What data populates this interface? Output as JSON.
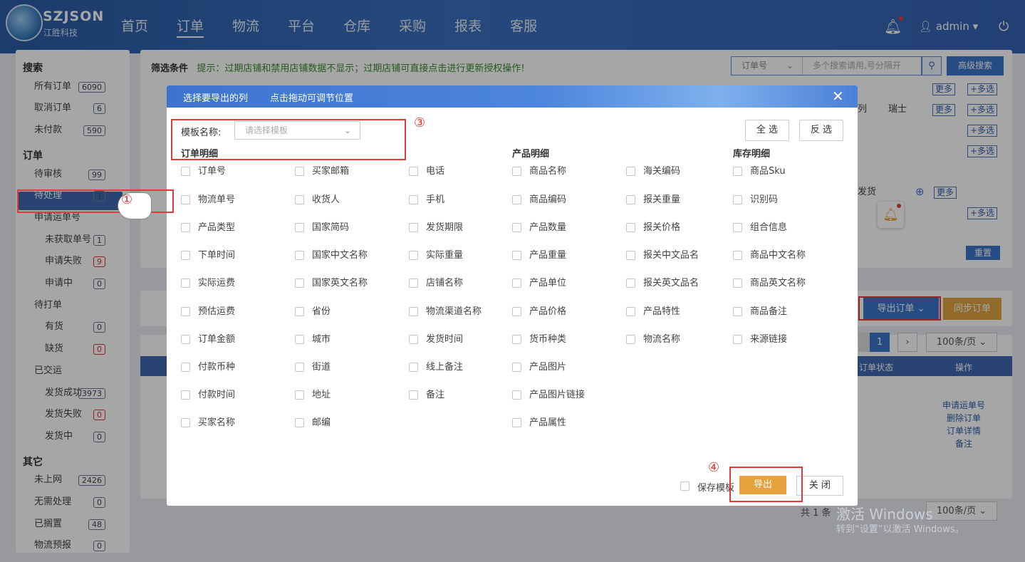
{
  "app": {
    "brand": "SZJSON",
    "brand_sub": "江胜科技"
  },
  "nav": {
    "items": [
      "首页",
      "订单",
      "物流",
      "平台",
      "仓库",
      "采购",
      "报表",
      "客服"
    ],
    "active_index": 1
  },
  "header": {
    "user": "admin",
    "user_icon": "user-icon",
    "bell_icon": "bell-icon",
    "power_icon": "power-icon"
  },
  "sidebar": {
    "sections": [
      {
        "title": "搜索",
        "items": [
          {
            "label": "所有订单",
            "count": "6090"
          },
          {
            "label": "取消订单",
            "count": "6"
          },
          {
            "label": "未付款",
            "count": "590"
          }
        ]
      },
      {
        "title": "订单",
        "items": [
          {
            "label": "待审核",
            "count": "99"
          },
          {
            "label": "待处理",
            "count": "1",
            "active": true
          },
          {
            "label": "申请运单号",
            "count": ""
          },
          {
            "label": "未获取单号",
            "count": "1"
          },
          {
            "label": "申请失败",
            "count": "9"
          },
          {
            "label": "申请中",
            "count": "0"
          },
          {
            "label": "待打单",
            "count": ""
          },
          {
            "label": "有货",
            "count": "0"
          },
          {
            "label": "缺货",
            "count": "0"
          },
          {
            "label": "已交运",
            "count": ""
          },
          {
            "label": "发货成功",
            "count": "3973"
          },
          {
            "label": "发货失败",
            "count": "0"
          },
          {
            "label": "发货中",
            "count": "0"
          }
        ]
      },
      {
        "title": "其它",
        "items": [
          {
            "label": "未上网",
            "count": "2426"
          },
          {
            "label": "无需处理",
            "count": "0"
          },
          {
            "label": "已搁置",
            "count": "48"
          },
          {
            "label": "物流预报",
            "count": "0"
          }
        ]
      }
    ]
  },
  "filter": {
    "title": "筛选条件",
    "hint": "提示：过期店铺和禁用店铺数据不显示；过期店铺可直接点击进行更新授权操作!",
    "search_select": "订单号",
    "search_placeholder": "多个搜索请用,号分隔开",
    "advanced_label": "高级搜索",
    "more_label": "更多",
    "multi_label": "+多选",
    "reset_label": "重置",
    "country_text": "瑞士",
    "row_col": "列",
    "ship_text": "发货"
  },
  "toolbar": {
    "export_label": "导出订单",
    "sync_label": "同步订单"
  },
  "table": {
    "columns": [
      "订单状态",
      "操作"
    ],
    "page": "1",
    "page_size": "100条/页",
    "total": "共 1 条",
    "ops": [
      "申请运单号",
      "删除订单",
      "订单详情",
      "备注"
    ]
  },
  "annotations": {
    "c1": "①",
    "c2": "②",
    "c3": "③",
    "c4": "④"
  },
  "modal": {
    "title": "选择要导出的列",
    "subtitle": "点击拖动可调节位置",
    "template_label": "模板名称:",
    "template_placeholder": "请选择模板",
    "select_all": "全 选",
    "invert": "反 选",
    "sections": {
      "order": "订单明细",
      "product": "产品明细",
      "stock": "库存明细"
    },
    "col1": [
      "订单号",
      "物流单号",
      "产品类型",
      "下单时间",
      "实际运费",
      "预估运费",
      "订单金额",
      "付款币种",
      "付款时间",
      "买家名称"
    ],
    "col2": [
      "买家邮箱",
      "收货人",
      "国家简码",
      "国家中文名称",
      "国家英文名称",
      "省份",
      "城市",
      "街道",
      "地址",
      "邮编"
    ],
    "col3": [
      "电话",
      "手机",
      "发货期限",
      "实际重量",
      "店铺名称",
      "物流渠道名称",
      "发货时间",
      "线上备注",
      "备注"
    ],
    "col4": [
      "商品名称",
      "商品编码",
      "产品数量",
      "产品重量",
      "产品单位",
      "产品价格",
      "货币种类",
      "产品图片",
      "产品图片链接",
      "产品属性"
    ],
    "col5": [
      "海关编码",
      "报关重量",
      "报关价格",
      "报关中文品名",
      "报关英文品名",
      "产品特性",
      "物流名称"
    ],
    "col6": [
      "商品Sku",
      "识别码",
      "组合信息",
      "商品中文名称",
      "商品英文名称",
      "商品备注",
      "来源链接"
    ],
    "save_template": "保存模板",
    "export_label": "导出",
    "close_label": "关 闭"
  },
  "watermark": {
    "line1": "激活 Windows",
    "line2": "转到“设置”以激活 Windows。"
  }
}
